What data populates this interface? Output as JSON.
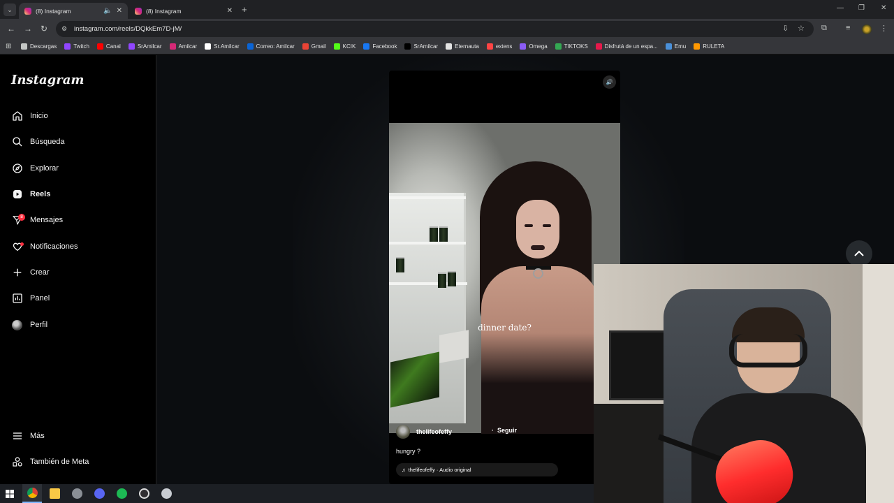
{
  "browser": {
    "tabs": [
      {
        "title": "(8) Instagram",
        "active": true
      },
      {
        "title": "(8) Instagram",
        "active": false
      }
    ],
    "url": "instagram.com/reels/DQkkEm7D-jM/",
    "bookmarks": [
      {
        "label": "Descargas",
        "color": "#c4c7c5"
      },
      {
        "label": "Twitch",
        "color": "#9146ff"
      },
      {
        "label": "Canal",
        "color": "#ff0000"
      },
      {
        "label": "SrAmilcar",
        "color": "#9146ff"
      },
      {
        "label": "Amilcar",
        "color": "#d62976"
      },
      {
        "label": "Sr.Amilcar",
        "color": "#ffffff"
      },
      {
        "label": "Correo: Amilcar",
        "color": "#0a64d6"
      },
      {
        "label": "Gmail",
        "color": "#ea4335"
      },
      {
        "label": "KCIK",
        "color": "#53fc18"
      },
      {
        "label": "Facebook",
        "color": "#1877f2"
      },
      {
        "label": "SrAmilcar",
        "color": "#000000"
      },
      {
        "label": "Eternauta",
        "color": "#e3e3e3"
      },
      {
        "label": "extens",
        "color": "#ff4444"
      },
      {
        "label": "Omega",
        "color": "#8b5cf6"
      },
      {
        "label": "TIKTOKS",
        "color": "#34a853"
      },
      {
        "label": "Disfrutá de un espa...",
        "color": "#e6194b"
      },
      {
        "label": "Emu",
        "color": "#4a90d9"
      },
      {
        "label": "RULETA",
        "color": "#ff9800"
      }
    ]
  },
  "sidebar": {
    "logo": "Instagram",
    "items": [
      {
        "label": "Inicio",
        "icon": "home-icon"
      },
      {
        "label": "Búsqueda",
        "icon": "search-icon"
      },
      {
        "label": "Explorar",
        "icon": "compass-icon"
      },
      {
        "label": "Reels",
        "icon": "reels-icon"
      },
      {
        "label": "Mensajes",
        "icon": "messenger-icon",
        "badge": "8"
      },
      {
        "label": "Notificaciones",
        "icon": "heart-icon"
      },
      {
        "label": "Crear",
        "icon": "plus-icon"
      },
      {
        "label": "Panel",
        "icon": "chart-icon"
      },
      {
        "label": "Perfil",
        "icon": "avatar"
      }
    ],
    "bottom": [
      {
        "label": "Más",
        "icon": "menu-icon"
      },
      {
        "label": "También de Meta",
        "icon": "meta-icon"
      }
    ]
  },
  "reel": {
    "overlay_text": "dinner date?",
    "username": "thelifeofeffy",
    "follow_label": "Seguir",
    "caption": "hungry ?",
    "audio": "thelifeofeffy · Audio original"
  },
  "colors": {
    "notification_red": "#ff3040",
    "chrome_dark": "#202124",
    "chrome_toolbar": "#35363a"
  }
}
